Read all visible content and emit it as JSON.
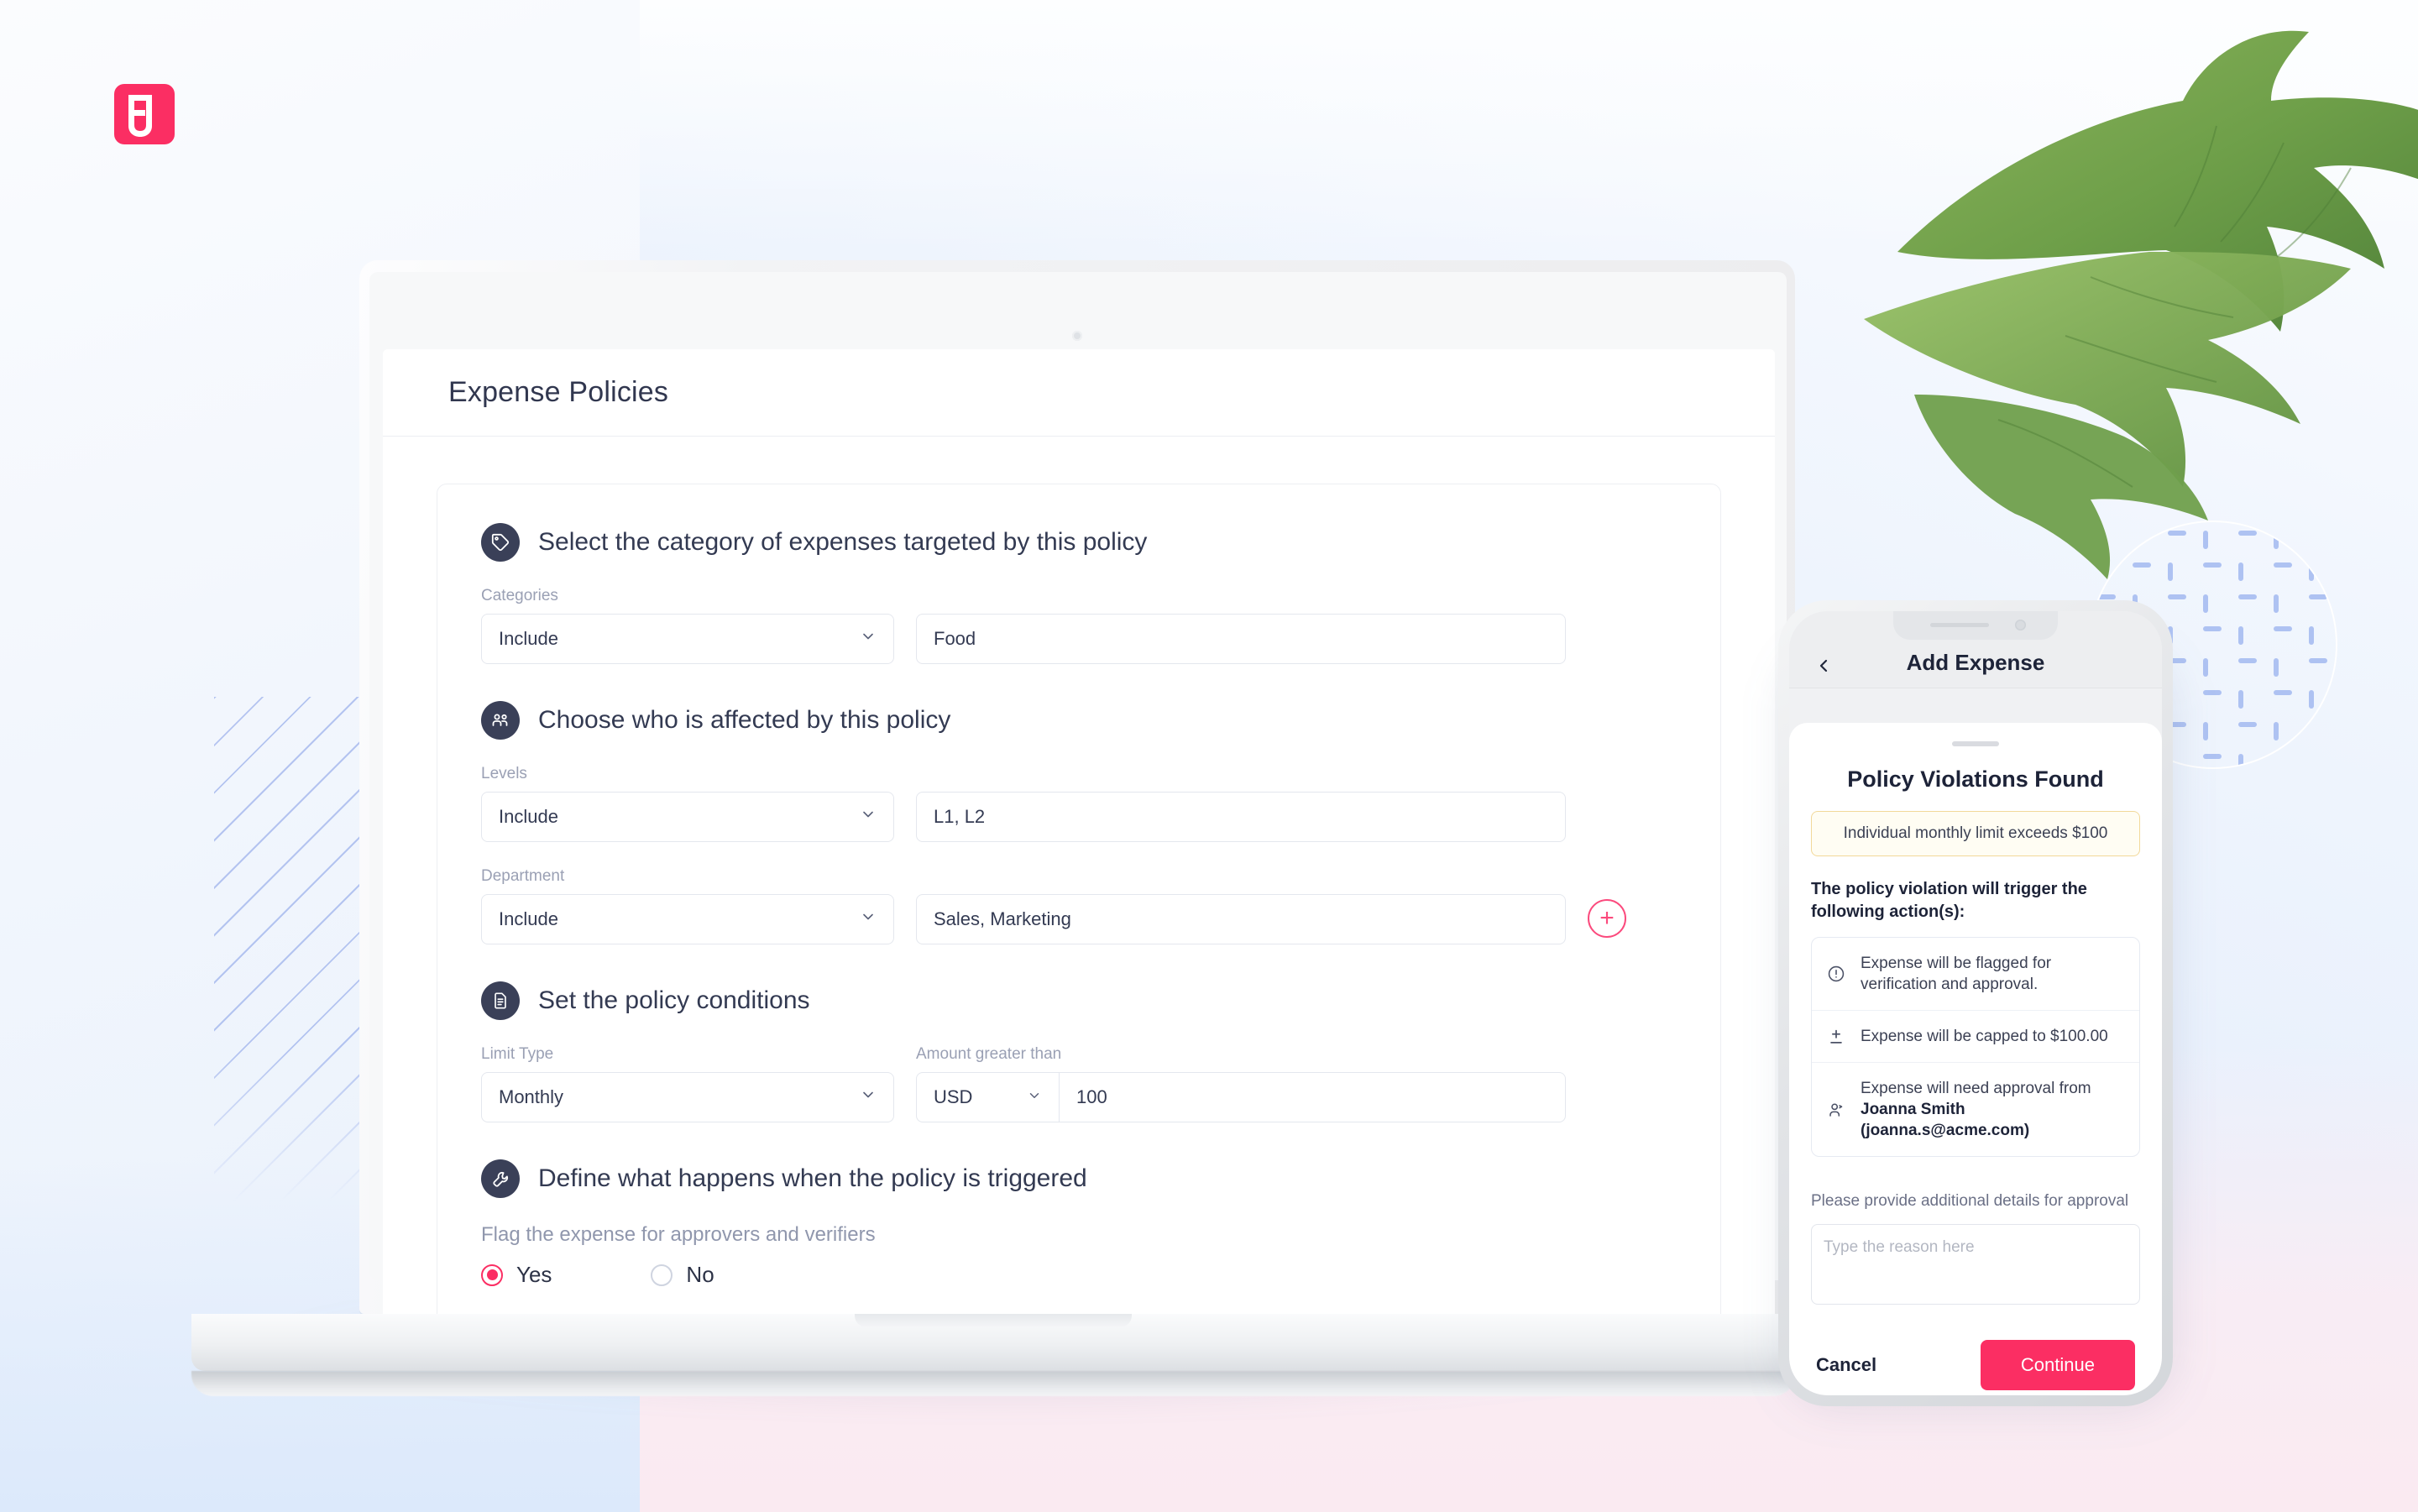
{
  "brand": {
    "logo_name": "fyle-logo",
    "accent_color": "#fb2e63",
    "icon_dark": "#3a4058"
  },
  "laptop": {
    "app": {
      "header": {
        "title": "Expense Policies"
      },
      "sections": [
        {
          "icon": "tag-icon",
          "title": "Select the category of expenses targeted by this policy",
          "fields": [
            {
              "label": "Categories",
              "select_value": "Include",
              "text_value": "Food"
            }
          ]
        },
        {
          "icon": "users-icon",
          "title": "Choose who is affected by this policy",
          "fields": [
            {
              "label": "Levels",
              "select_value": "Include",
              "text_value": "L1, L2"
            },
            {
              "label": "Department",
              "select_value": "Include",
              "text_value": "Sales, Marketing",
              "add_button": "+"
            }
          ]
        },
        {
          "icon": "document-icon",
          "title": "Set the policy conditions",
          "limit_label": "Limit Type",
          "limit_value": "Monthly",
          "amount_label": "Amount greater than",
          "currency_value": "USD",
          "amount_value": "100"
        },
        {
          "icon": "wrench-icon",
          "title": "Define what happens when the policy is triggered",
          "question": "Flag the expense for approvers and verifiers",
          "options": [
            {
              "label": "Yes",
              "selected": true
            },
            {
              "label": "No",
              "selected": false
            }
          ]
        }
      ]
    }
  },
  "phone": {
    "nav": {
      "back_icon": "chevron-left-icon",
      "title": "Add Expense"
    },
    "sheet": {
      "title": "Policy Violations Found",
      "violation": "Individual monthly limit exceeds $100",
      "trigger_intro": "The policy violation will trigger the following action(s):",
      "actions": [
        {
          "icon": "alert-circle-icon",
          "text": "Expense will be flagged for verification and approval."
        },
        {
          "icon": "plus-minus-icon",
          "text": "Expense will be capped to $100.00"
        },
        {
          "icon": "user-check-icon",
          "text_plain": "Expense will need approval from ",
          "text_bold": "Joanna Smith (joanna.s@acme.com)"
        }
      ],
      "reason_label": "Please provide additional details for approval",
      "reason_placeholder": "Type the reason here",
      "cancel_label": "Cancel",
      "continue_label": "Continue"
    }
  }
}
